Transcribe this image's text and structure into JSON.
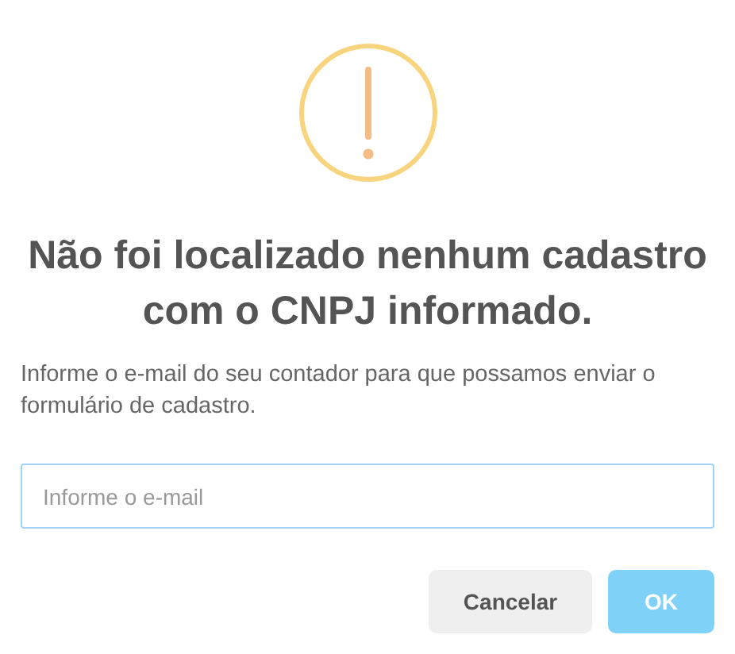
{
  "title": "Não foi localizado nenhum cadastro com o CNPJ informado.",
  "message": "Informe o e-mail do seu contador para que possamos enviar o formulário de cadastro.",
  "email_field": {
    "placeholder": "Informe o e-mail"
  },
  "buttons": [
    {
      "label": "Cancelar",
      "kind": "cancel",
      "disabled": false
    },
    {
      "label": "OK",
      "kind": "confirm",
      "disabled": true
    }
  ]
}
